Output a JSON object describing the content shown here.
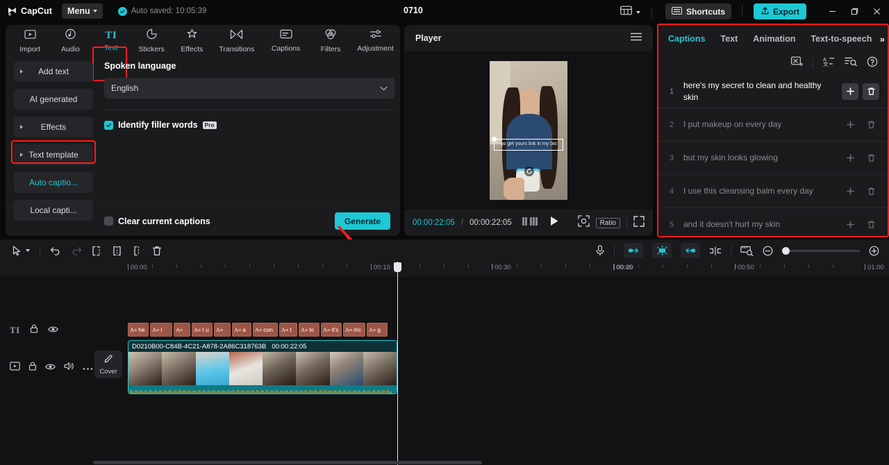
{
  "titlebar": {
    "logo_text": "CapCut",
    "menu_label": "Menu",
    "autosave_text": "Auto saved: 10:05:39",
    "project_title": "0710",
    "shortcuts_label": "Shortcuts",
    "export_label": "Export"
  },
  "toolbar_tabs": [
    {
      "label": "Import",
      "icon": "import-icon",
      "active": false
    },
    {
      "label": "Audio",
      "icon": "audio-icon",
      "active": false
    },
    {
      "label": "Text",
      "icon": "text-icon",
      "active": true
    },
    {
      "label": "Stickers",
      "icon": "stickers-icon",
      "active": false
    },
    {
      "label": "Effects",
      "icon": "effects-icon",
      "active": false
    },
    {
      "label": "Transitions",
      "icon": "transitions-icon",
      "active": false
    },
    {
      "label": "Captions",
      "icon": "captions-icon",
      "active": false
    },
    {
      "label": "Filters",
      "icon": "filters-icon",
      "active": false
    },
    {
      "label": "Adjustment",
      "icon": "adjustment-icon",
      "active": false
    }
  ],
  "sidebar": {
    "items": [
      {
        "label": "Add text",
        "expandable": true,
        "active": false
      },
      {
        "label": "AI generated",
        "expandable": false,
        "active": false
      },
      {
        "label": "Effects",
        "expandable": true,
        "active": false
      },
      {
        "label": "Text template",
        "expandable": true,
        "active": false
      },
      {
        "label": "Auto captio...",
        "expandable": false,
        "active": true
      },
      {
        "label": "Local capti...",
        "expandable": false,
        "active": false
      }
    ]
  },
  "panel": {
    "spoken_language_label": "Spoken language",
    "language_value": "English",
    "filler_words_label": "Identify filler words",
    "filler_words_badge": "Pro",
    "filler_words_checked": true,
    "clear_captions_label": "Clear current captions",
    "clear_captions_checked": false,
    "generate_label": "Generate"
  },
  "player": {
    "title": "Player",
    "current_time": "00:00:22:05",
    "time_separator": "/",
    "total_time": "00:00:22:05",
    "ratio_label": "Ratio",
    "overlay_caption": "go get yours link in my bio"
  },
  "captions_panel": {
    "tabs": [
      {
        "label": "Captions",
        "active": true
      },
      {
        "label": "Text",
        "active": false
      },
      {
        "label": "Animation",
        "active": false
      },
      {
        "label": "Text-to-speech",
        "active": false
      }
    ],
    "overflow_glyph": "»",
    "tools": [
      {
        "icon": "auto-cut-icon"
      },
      {
        "icon": "translate-icon"
      },
      {
        "icon": "find-replace-icon"
      },
      {
        "icon": "help-icon"
      }
    ],
    "items": [
      {
        "num": "1",
        "text": "here's my secret to clean and healthy skin",
        "active": true
      },
      {
        "num": "2",
        "text": "I put makeup on every day",
        "active": false
      },
      {
        "num": "3",
        "text": "but my skin looks glowing",
        "active": false
      },
      {
        "num": "4",
        "text": "I use this cleansing balm every day",
        "active": false
      },
      {
        "num": "5",
        "text": "and it doesn't hurt my skin",
        "active": false
      }
    ]
  },
  "timeline": {
    "ruler_labels": [
      "00:00",
      "00:10",
      "00:20",
      "00:30",
      "00:40",
      "00:50",
      "01:00"
    ],
    "cover_label": "Cover",
    "video_clip": {
      "name": "D0210B00-С84B-4C21-A878-2A86C318763B",
      "duration": "00:00:22:05"
    },
    "text_clips": [
      "he",
      "I",
      "",
      "I u",
      "",
      "a",
      "con",
      "t",
      "lo",
      "it's",
      "inc",
      "g"
    ],
    "text_clip_icon": "A≡"
  },
  "colors": {
    "accent": "#1ec8d4",
    "highlight": "#ff1a1a",
    "panel_bg": "#1b1b1e",
    "text_clip": "#9d5546"
  }
}
